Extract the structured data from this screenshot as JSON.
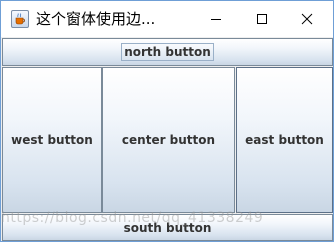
{
  "window": {
    "title": "这个窗体使用边...",
    "app_icon": "java-coffee-icon",
    "controls": {
      "minimize": "minimize-icon",
      "maximize": "maximize-icon",
      "close": "close-icon"
    }
  },
  "buttons": {
    "north": "north button",
    "west": "west button",
    "center": "center button",
    "east": "east button",
    "south": "south button"
  },
  "watermark": "https://blog.csdn.net/qq_41338249",
  "colors": {
    "button_gradient_top": "#ffffff",
    "button_gradient_bottom": "#c9d6e4",
    "button_border": "#7a8a99",
    "window_border": "#6f9fd6"
  }
}
